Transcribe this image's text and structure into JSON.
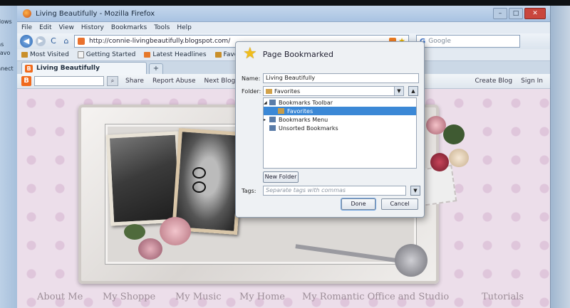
{
  "window": {
    "title": "Living Beautifully - Mozilla Firefox",
    "min": "–",
    "max": "□",
    "close": "✕"
  },
  "menu": [
    "File",
    "Edit",
    "View",
    "History",
    "Bookmarks",
    "Tools",
    "Help"
  ],
  "nav": {
    "back": "◀",
    "forward": "▶",
    "reload": "C",
    "home": "⌂",
    "url": "http://connie-livingbeautifully.blogspot.com/",
    "search_placeholder": "Google"
  },
  "bookmarks_bar": [
    "Most Visited",
    "Getting Started",
    "Latest Headlines",
    "Favorites"
  ],
  "tab": {
    "label": "Living Beautifully",
    "new_tab": "+"
  },
  "blogger_bar": {
    "logo": "B",
    "search_btn": "⌕",
    "links": [
      "Share",
      "Report Abuse",
      "Next Blog»"
    ],
    "right_links": [
      "Create Blog",
      "Sign In"
    ]
  },
  "blog_nav": [
    "About Me",
    "My Shoppe",
    "My Music",
    "My Home",
    "My Romantic Office and Studio",
    "Tutorials"
  ],
  "left_window_text": [
    "dows",
    "ns",
    "Favo",
    "nnect"
  ],
  "dialog": {
    "title": "Page Bookmarked",
    "name_label": "Name:",
    "name_value": "Living Beautifully",
    "folder_label": "Folder:",
    "folder_value": "Favorites",
    "dropdown": "▼",
    "expander": "▲",
    "tree": [
      {
        "label": "Bookmarks Toolbar",
        "twisty": "◢",
        "icon": "bookmark"
      },
      {
        "label": "Favorites",
        "twisty": "",
        "icon": "folder",
        "selected": true
      },
      {
        "label": "Bookmarks Menu",
        "twisty": "▸",
        "icon": "bookmark"
      },
      {
        "label": "Unsorted Bookmarks",
        "twisty": "",
        "icon": "bookmark"
      }
    ],
    "new_folder": "New Folder",
    "tags_label": "Tags:",
    "tags_placeholder": "Separate tags with commas",
    "tags_dropdown": "▼",
    "done": "Done",
    "cancel": "Cancel"
  },
  "colors": {
    "accent": "#3b88d6",
    "blogger_orange": "#f06a1d",
    "star_yellow": "#f0bd1c"
  }
}
